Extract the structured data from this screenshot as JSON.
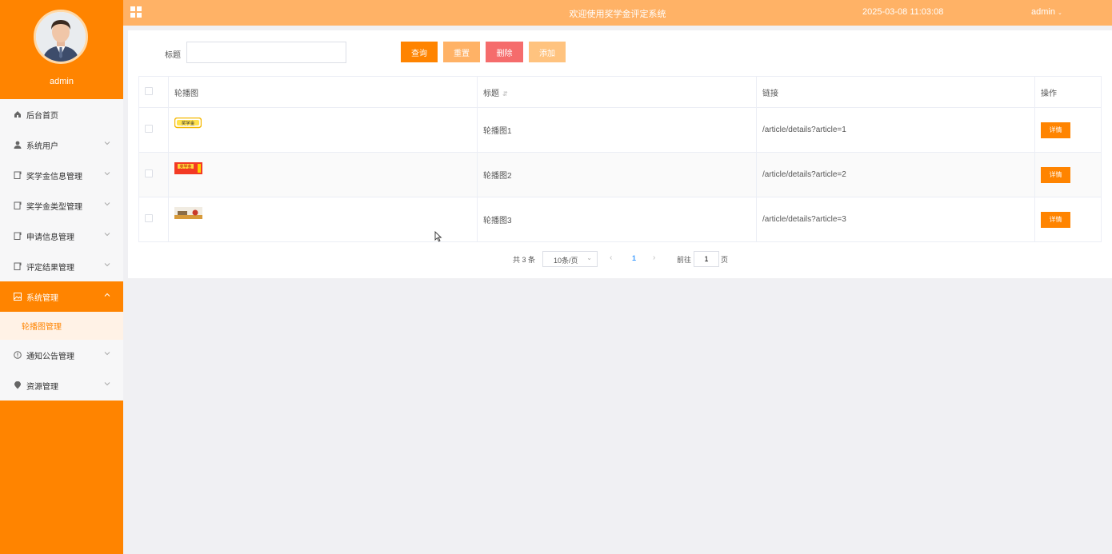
{
  "sidebar": {
    "profile_name": "admin",
    "menu": [
      {
        "label": "后台首页",
        "icon": "home-icon"
      },
      {
        "label": "系统用户",
        "icon": "user-icon"
      },
      {
        "label": "奖学金信息管理",
        "icon": "document-icon"
      },
      {
        "label": "奖学金类型管理",
        "icon": "document-icon"
      },
      {
        "label": "申请信息管理",
        "icon": "document-icon"
      },
      {
        "label": "评定结果管理",
        "icon": "document-icon"
      },
      {
        "label": "系统管理",
        "icon": "picture-icon"
      },
      {
        "label": "通知公告管理",
        "icon": "info-icon"
      },
      {
        "label": "资源管理",
        "icon": "location-icon"
      }
    ],
    "submenu": {
      "label": "轮播图管理"
    }
  },
  "header": {
    "title": "欢迎使用奖学金评定系统",
    "time": "2025-03-08 11:03:08",
    "user": "admin"
  },
  "search": {
    "label": "标题",
    "value": "",
    "buttons": {
      "query": "查询",
      "reset": "重置",
      "delete": "删除",
      "add": "添加"
    }
  },
  "table": {
    "columns": [
      "轮播图",
      "标题",
      "链接",
      "操作"
    ],
    "rows": [
      {
        "title": "轮播图1",
        "link": "/article/details?article=1",
        "thumb_text": "奖学金",
        "action": "详情"
      },
      {
        "title": "轮播图2",
        "link": "/article/details?article=2",
        "thumb_text": "奖学金",
        "action": "详情"
      },
      {
        "title": "轮播图3",
        "link": "/article/details?article=3",
        "thumb_text": "",
        "action": "详情"
      }
    ]
  },
  "pagination": {
    "total": "共 3 条",
    "page_size": "10条/页",
    "current_page": "1",
    "goto_label": "前往",
    "goto_value": "1",
    "page_unit": "页"
  },
  "colors": {
    "primary": "#ff8400",
    "header": "#ffb266",
    "danger": "#f56c6c"
  }
}
